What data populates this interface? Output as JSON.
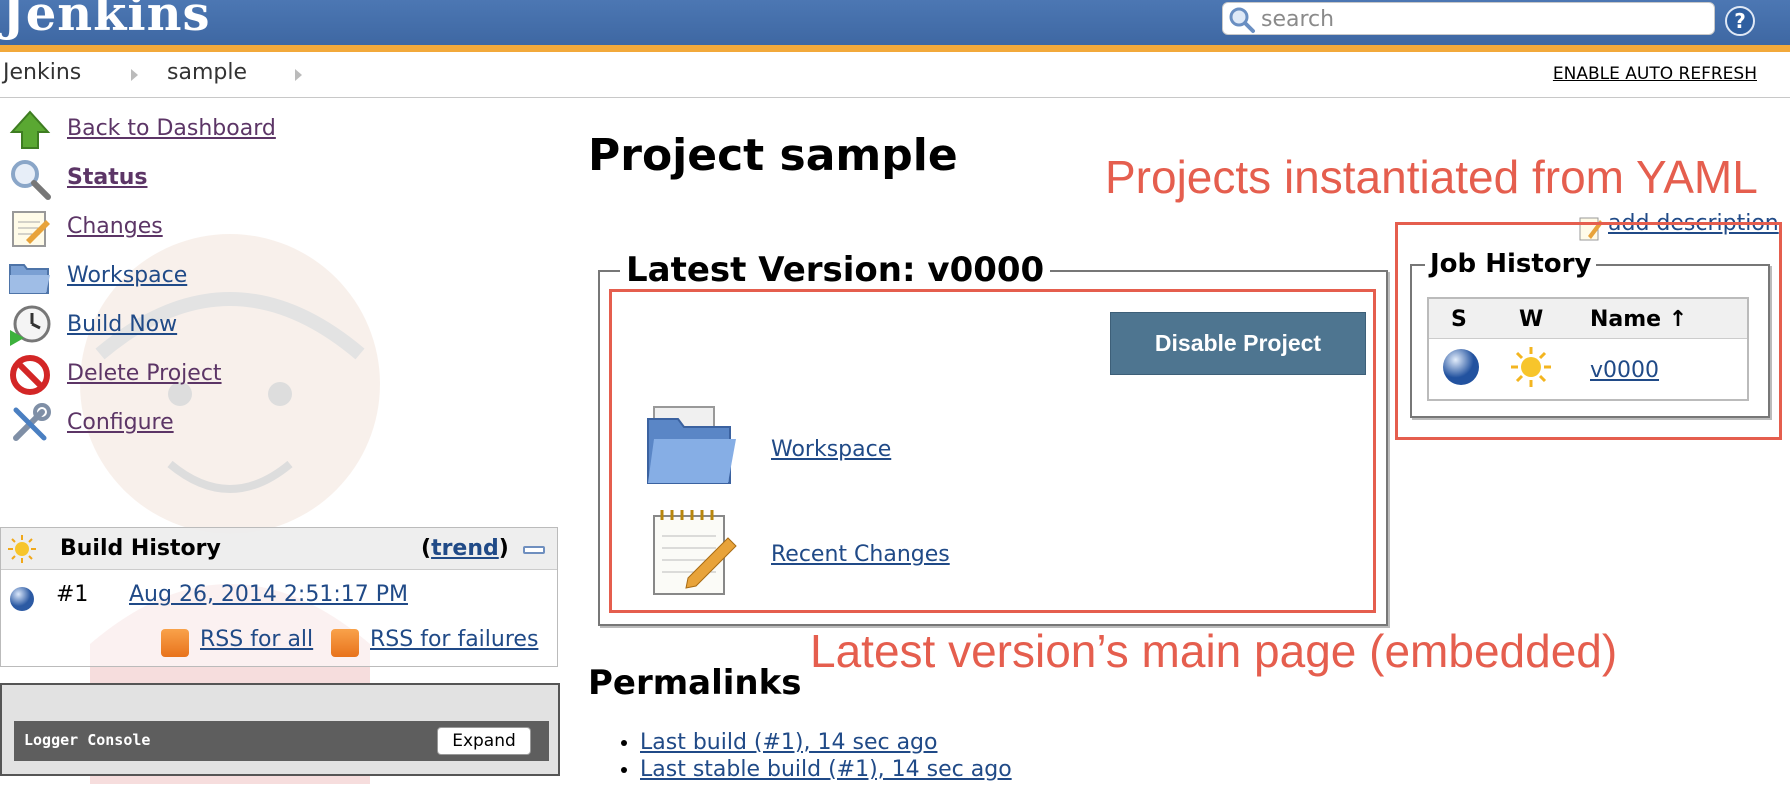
{
  "header": {
    "logo": "Jenkins",
    "search_placeholder": "search",
    "help_symbol": "?"
  },
  "breadcrumb": {
    "items": [
      "Jenkins",
      "sample"
    ],
    "auto_refresh": "ENABLE AUTO REFRESH"
  },
  "sidebar": {
    "tasks": [
      {
        "label": "Back to Dashboard",
        "icon": "up-arrow-icon"
      },
      {
        "label": "Status",
        "icon": "search-icon"
      },
      {
        "label": "Changes",
        "icon": "notepad-icon"
      },
      {
        "label": "Workspace",
        "icon": "folder-icon"
      },
      {
        "label": "Build Now",
        "icon": "clock-icon"
      },
      {
        "label": "Delete Project",
        "icon": "no-entry-icon"
      },
      {
        "label": "Configure",
        "icon": "wrench-icon"
      }
    ],
    "build_history": {
      "title": "Build History",
      "trend": "trend",
      "build_number": "#1",
      "build_date": "Aug 26, 2014 2:51:17 PM",
      "rss_all": "RSS for all",
      "rss_failures": "RSS for failures"
    },
    "logger": {
      "title": "Logger Console",
      "expand": "Expand"
    }
  },
  "main": {
    "title": "Project sample",
    "add_description": "add description",
    "latest_version": {
      "legend": "Latest Version: v0000",
      "disable_button": "Disable Project",
      "workspace": "Workspace",
      "recent_changes": "Recent Changes"
    },
    "permalinks": {
      "title": "Permalinks",
      "items": [
        "Last build (#1), 14 sec ago",
        "Last stable build (#1), 14 sec ago"
      ]
    }
  },
  "job_history": {
    "legend": "Job History",
    "columns": [
      "S",
      "W",
      "Name ↑"
    ],
    "rows": [
      {
        "name": "v0000"
      }
    ]
  },
  "annotations": {
    "yaml": "Projects instantiated from YAML",
    "embedded": "Latest version’s main page (embedded)"
  },
  "colors": {
    "header_blue": "#3c65a0",
    "header_stripe": "#f2a93b",
    "link": "#204A87",
    "annotation_red": "#e55e4e",
    "disable_button": "#4e7590"
  }
}
